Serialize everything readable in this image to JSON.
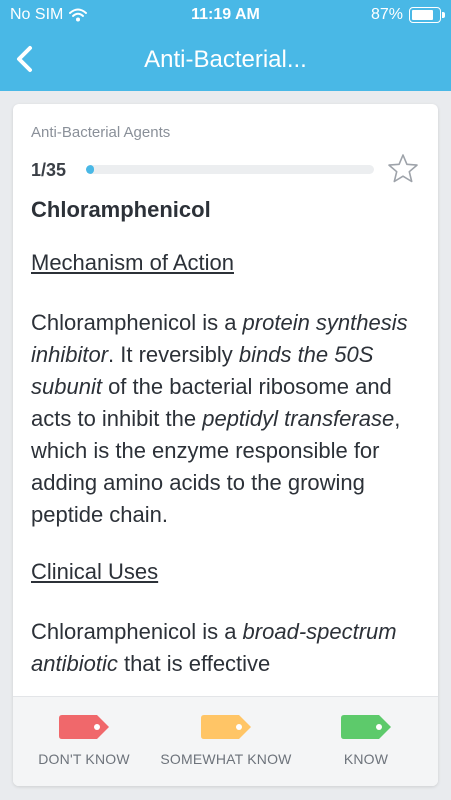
{
  "status_bar": {
    "carrier": "No SIM",
    "time": "11:19 AM",
    "battery_percent": "87%",
    "battery_level": 0.87
  },
  "nav": {
    "title": "Anti-Bacterial...",
    "back_icon": "chevron-left-icon"
  },
  "card": {
    "deck_name": "Anti-Bacterial Agents",
    "progress_label": "1/35",
    "progress_fraction": 0.0286,
    "star_icon": "star-outline-icon",
    "title": "Chloramphenicol",
    "section1_heading": "Mechanism of Action",
    "para1": {
      "t1": "Chloramphenicol is a ",
      "e1": "protein synthesis inhibitor",
      "t2": ". It reversibly ",
      "e2": "binds the 50S subunit",
      "t3": " of the bacterial ribosome and acts to inhibit the ",
      "e3": "peptidyl transferase",
      "t4": ", which is the enzyme responsible for adding amino acids to the growing peptide chain."
    },
    "section2_heading": "Clinical Uses",
    "para2": {
      "t1": "Chloramphenicol is a ",
      "e1": "broad-spectrum antibiotic",
      "t2": " that is effective"
    }
  },
  "footer": {
    "dont_know": "DON'T KNOW",
    "somewhat_know": "SOMEWHAT KNOW",
    "know": "KNOW",
    "colors": {
      "dont_know": "#f0686b",
      "somewhat_know": "#ffc566",
      "know": "#5dca6b"
    }
  },
  "colors": {
    "accent": "#49b8e6"
  }
}
